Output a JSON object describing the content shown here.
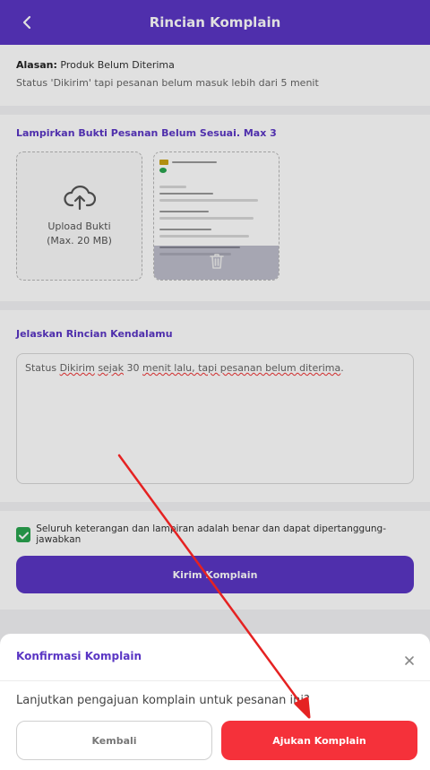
{
  "header": {
    "title": "Rincian Komplain",
    "back_icon": "chevron-left-icon"
  },
  "reason": {
    "label": "Alasan:",
    "value": "Produk Belum Diterima",
    "status_text": "Status 'Dikirim' tapi pesanan belum masuk lebih dari 5 menit"
  },
  "attachments": {
    "title": "Lampirkan Bukti Pesanan Belum Sesuai. Max 3",
    "upload_label": "Upload Bukti",
    "upload_hint": "(Max. 20 MB)",
    "upload_icon": "cloud-upload-icon",
    "delete_icon": "trash-icon"
  },
  "details": {
    "title": "Jelaskan Rincian Kendalamu",
    "text_plain_1": "Status ",
    "text_wavy_1": "Dikirim",
    "text_plain_2": " ",
    "text_wavy_2": "sejak",
    "text_plain_3": " 30 ",
    "text_wavy_3": "menit lalu, tapi pesanan belum diterima",
    "text_plain_4": "."
  },
  "confirm_check": {
    "checked": true,
    "label": "Seluruh keterangan dan lampiran adalah benar dan dapat dipertanggung-jawabkan"
  },
  "submit_button": "Kirim Komplain",
  "dialog": {
    "title": "Konfirmasi Komplain",
    "message": "Lanjutkan pengajuan komplain untuk pesanan ini?",
    "cancel_label": "Kembali",
    "confirm_label": "Ajukan Komplain",
    "close_icon": "close-icon"
  },
  "colors": {
    "primary": "#5a36c4",
    "danger": "#f5313a",
    "success": "#2aa44f",
    "annotation_arrow": "#e52222"
  }
}
